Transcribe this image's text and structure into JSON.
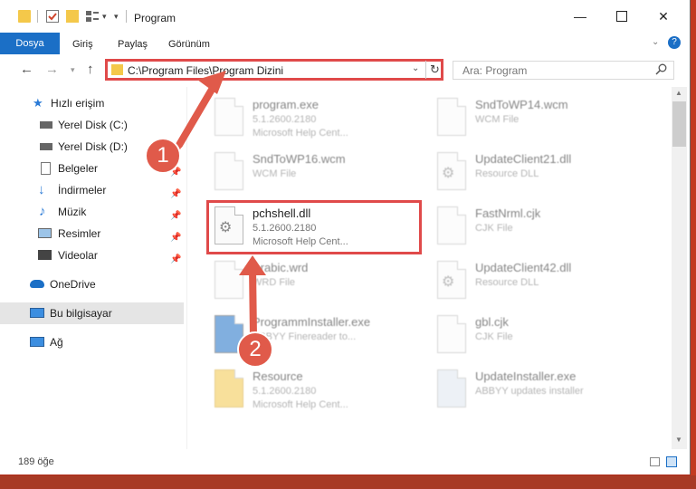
{
  "window": {
    "title": "Program"
  },
  "ribbon": {
    "tabs": [
      "Dosya",
      "Giriş",
      "Paylaş",
      "Görünüm"
    ]
  },
  "address": {
    "path": "C:\\Program Files\\Program Dizini"
  },
  "search": {
    "placeholder": "Ara: Program"
  },
  "sidebar": {
    "items": [
      {
        "label": "Hızlı erişim"
      },
      {
        "label": "Yerel Disk (C:)"
      },
      {
        "label": "Yerel Disk (D:)"
      },
      {
        "label": "Belgeler"
      },
      {
        "label": "İndirmeler"
      },
      {
        "label": "Müzik"
      },
      {
        "label": "Resimler"
      },
      {
        "label": "Videolar"
      },
      {
        "label": "OneDrive"
      },
      {
        "label": "Bu bilgisayar"
      },
      {
        "label": "Ağ"
      }
    ]
  },
  "files": [
    {
      "name": "program.exe",
      "line1": "5.1.2600.2180",
      "line2": "Microsoft Help Cent..."
    },
    {
      "name": "SndToWP14.wcm",
      "line1": "WCM File",
      "line2": ""
    },
    {
      "name": "SndToWP16.wcm",
      "line1": "WCM File",
      "line2": ""
    },
    {
      "name": "UpdateClient21.dll",
      "line1": "Resource DLL",
      "line2": ""
    },
    {
      "name": "pchshell.dll",
      "line1": "5.1.2600.2180",
      "line2": "Microsoft Help Cent..."
    },
    {
      "name": "FastNrml.cjk",
      "line1": "CJK File",
      "line2": ""
    },
    {
      "name": "Arabic.wrd",
      "line1": "WRD File",
      "line2": ""
    },
    {
      "name": "UpdateClient42.dll",
      "line1": "Resource DLL",
      "line2": ""
    },
    {
      "name": "ProgrammInstaller.exe",
      "line1": "ABBYY Finereader to...",
      "line2": ""
    },
    {
      "name": "gbl.cjk",
      "line1": "CJK File",
      "line2": ""
    },
    {
      "name": "Resource",
      "line1": "5.1.2600.2180",
      "line2": "Microsoft Help Cent..."
    },
    {
      "name": "UpdateInstaller.exe",
      "line1": "ABBYY updates installer",
      "line2": ""
    }
  ],
  "status": {
    "count": "189 öğe"
  },
  "annotations": [
    "1",
    "2"
  ]
}
